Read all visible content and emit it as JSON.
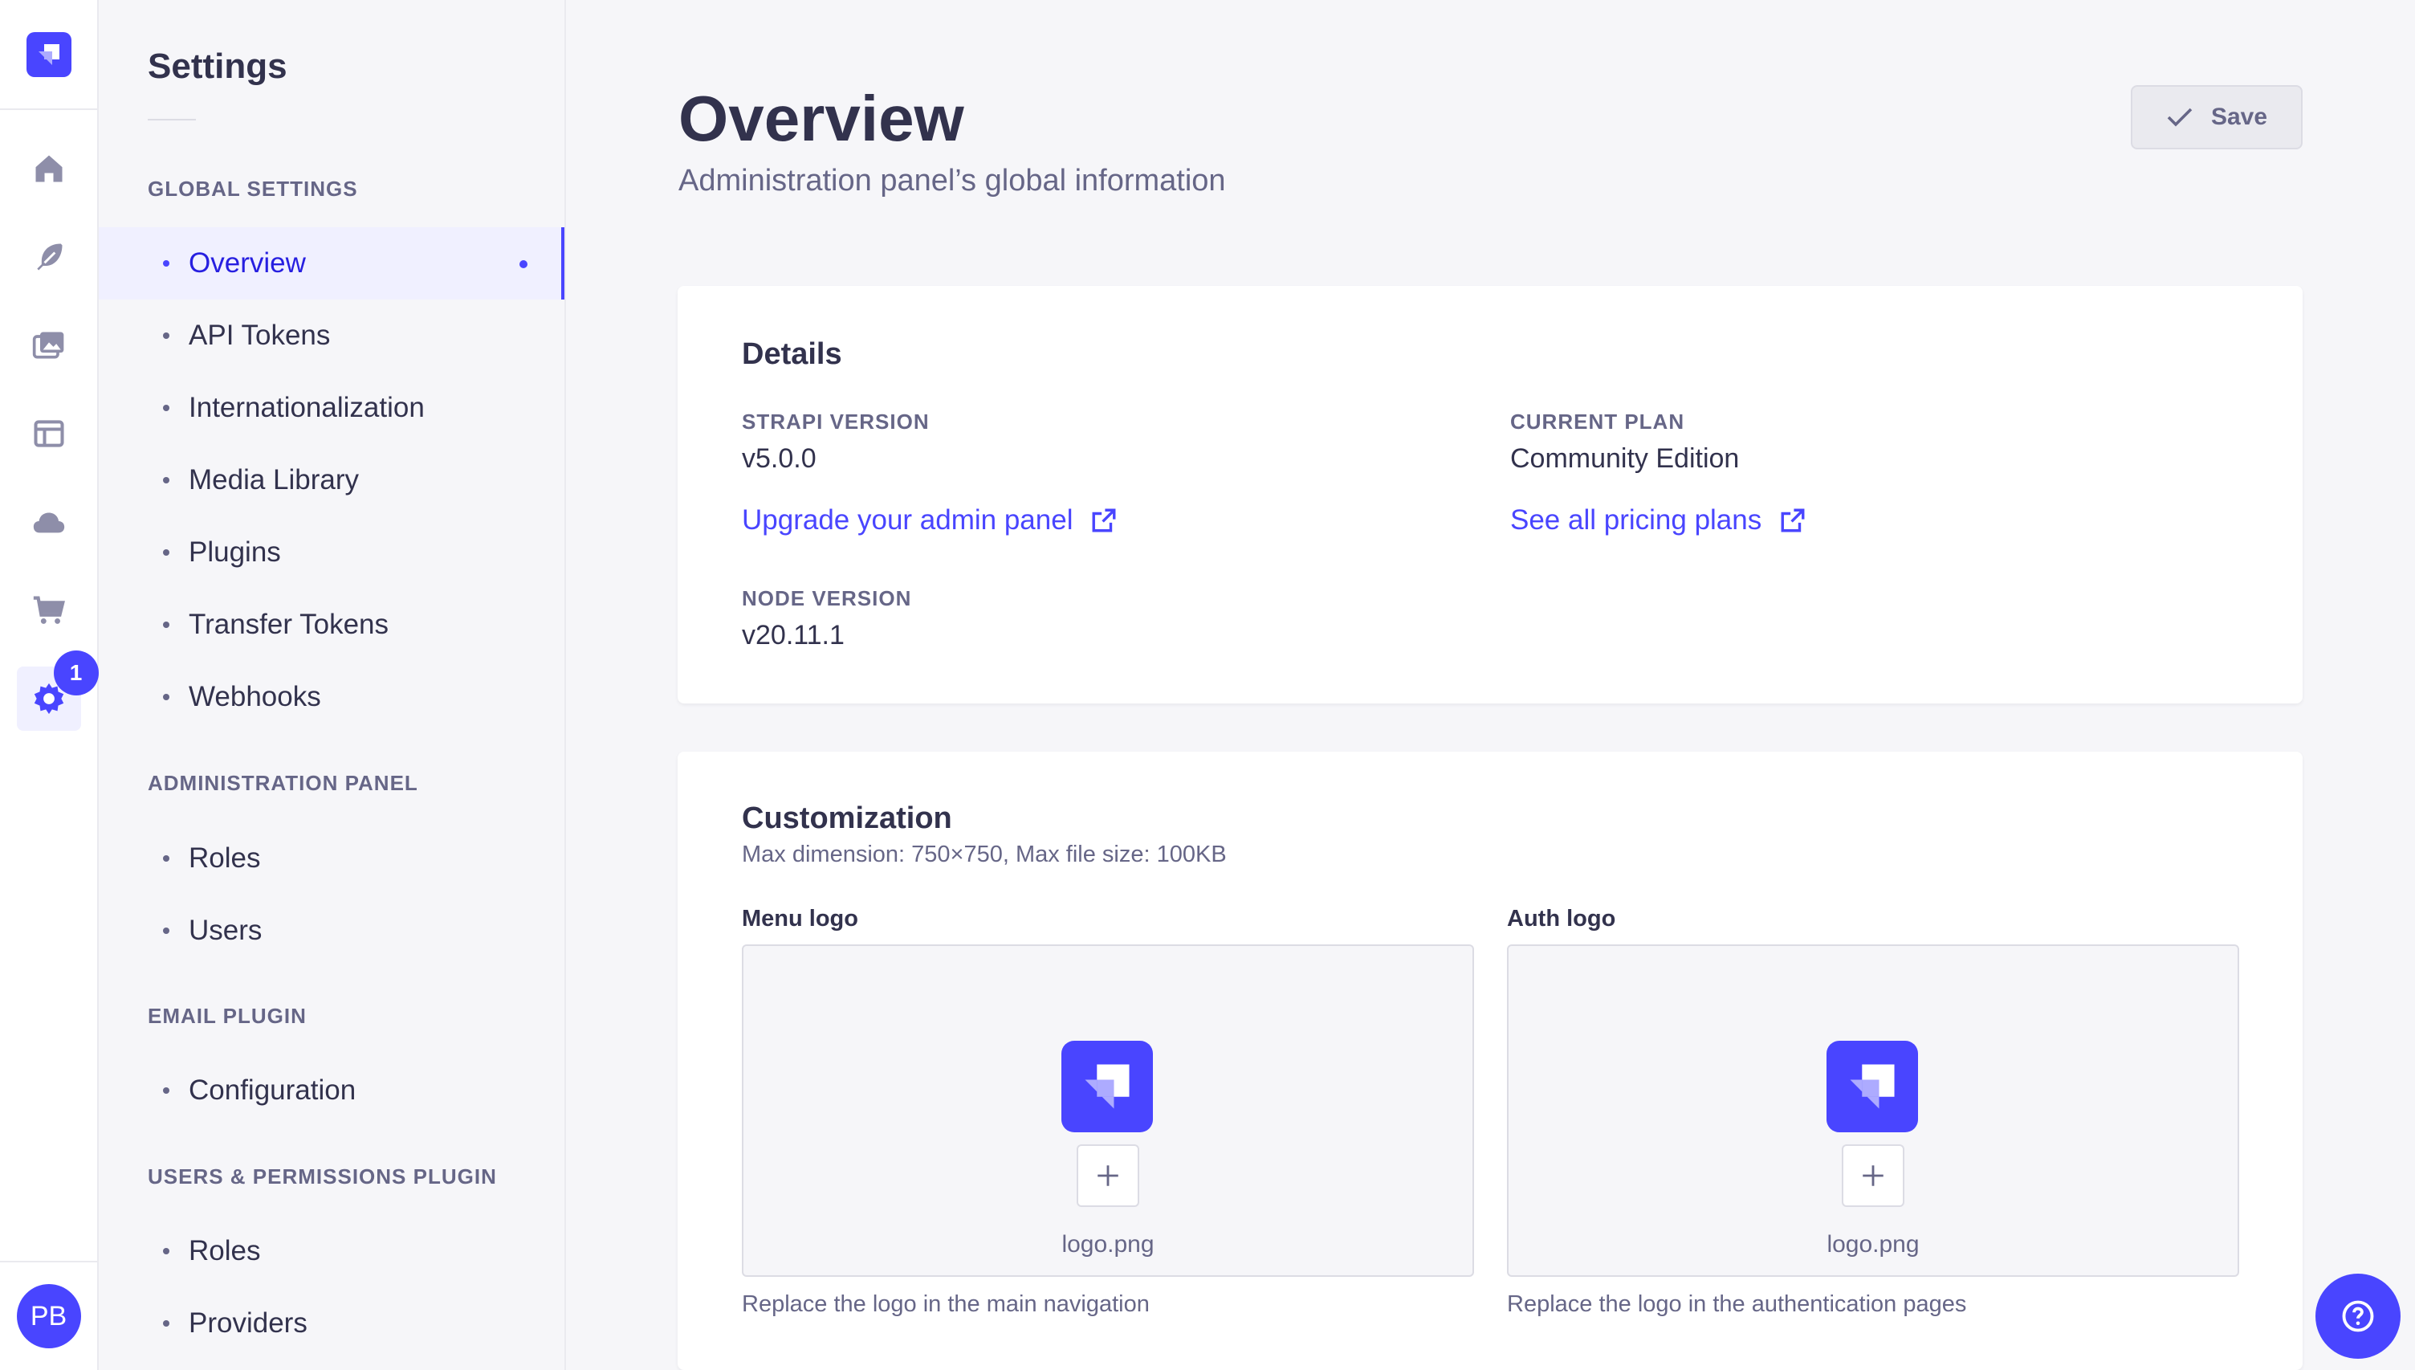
{
  "rail": {
    "brand_icon": "strapi-logo-icon",
    "items": [
      {
        "name": "home-icon"
      },
      {
        "name": "feather-icon"
      },
      {
        "name": "media-icon"
      },
      {
        "name": "layout-icon"
      },
      {
        "name": "cloud-icon"
      },
      {
        "name": "cart-icon"
      },
      {
        "name": "settings-gear-icon",
        "badge": "1"
      }
    ],
    "avatar_initials": "PB"
  },
  "subnav": {
    "title": "Settings",
    "sections": [
      {
        "label": "GLOBAL SETTINGS",
        "items": [
          "Overview",
          "API Tokens",
          "Internationalization",
          "Media Library",
          "Plugins",
          "Transfer Tokens",
          "Webhooks"
        ]
      },
      {
        "label": "ADMINISTRATION PANEL",
        "items": [
          "Roles",
          "Users"
        ]
      },
      {
        "label": "EMAIL PLUGIN",
        "items": [
          "Configuration"
        ]
      },
      {
        "label": "USERS & PERMISSIONS PLUGIN",
        "items": [
          "Roles",
          "Providers"
        ]
      }
    ],
    "active_item": "Overview"
  },
  "header": {
    "title": "Overview",
    "subtitle": "Administration panel’s global information",
    "save_label": "Save"
  },
  "details": {
    "heading": "Details",
    "strapi_version_label": "STRAPI VERSION",
    "strapi_version_value": "v5.0.0",
    "upgrade_link": "Upgrade your admin panel",
    "current_plan_label": "CURRENT PLAN",
    "current_plan_value": "Community Edition",
    "pricing_link": "See all pricing plans",
    "node_version_label": "NODE VERSION",
    "node_version_value": "v20.11.1"
  },
  "customization": {
    "heading": "Customization",
    "hint": "Max dimension: 750×750, Max file size: 100KB",
    "menu_logo": {
      "label": "Menu logo",
      "file_name": "logo.png",
      "help": "Replace the logo in the main navigation"
    },
    "auth_logo": {
      "label": "Auth logo",
      "file_name": "logo.png",
      "help": "Replace the logo in the authentication pages"
    }
  },
  "colors": {
    "primary": "#4945ff",
    "text": "#32324d",
    "muted": "#666687",
    "background": "#f6f6f9"
  }
}
